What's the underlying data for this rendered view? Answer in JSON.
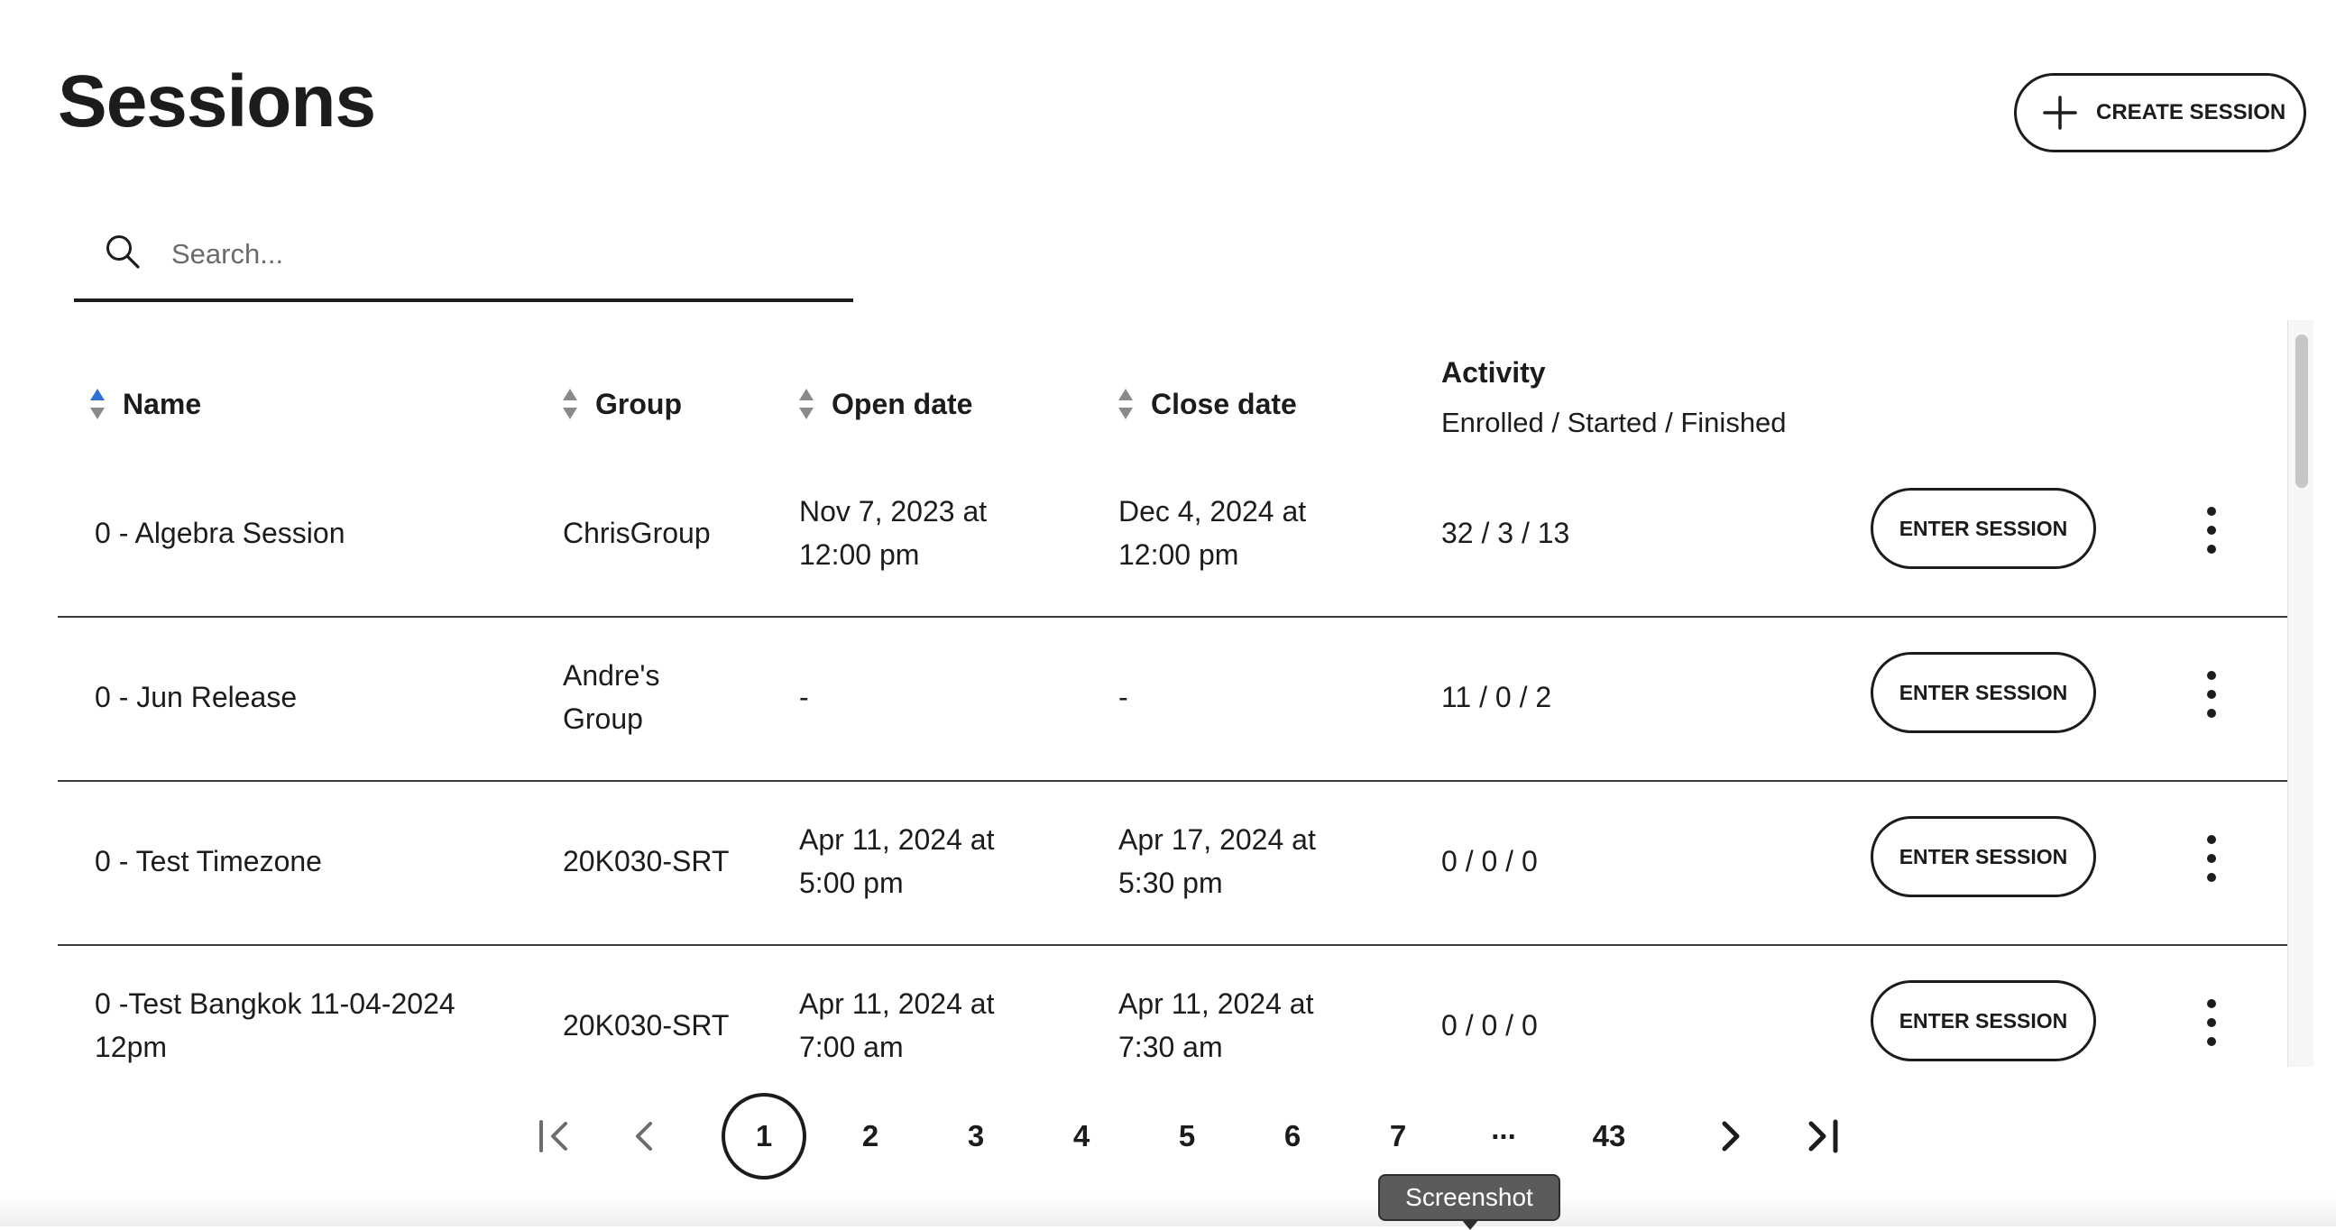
{
  "page": {
    "title": "Sessions",
    "create_button_label": "CREATE SESSION"
  },
  "search": {
    "placeholder": "Search...",
    "value": ""
  },
  "table": {
    "headers": {
      "name": "Name",
      "group": "Group",
      "open_date": "Open date",
      "close_date": "Close date",
      "activity": "Activity",
      "activity_sub": "Enrolled / Started / Finished"
    },
    "sorted_column": "name",
    "sort_direction": "ascending",
    "enter_label": "ENTER SESSION",
    "rows": [
      {
        "name": [
          "0 - Algebra Session"
        ],
        "group": [
          "ChrisGroup"
        ],
        "open": [
          "Nov 7, 2023 at",
          "12:00 pm"
        ],
        "close": [
          "Dec 4, 2024 at",
          "12:00 pm"
        ],
        "activity": "32 / 3 / 13"
      },
      {
        "name": [
          "0 - Jun Release"
        ],
        "group": [
          "Andre's",
          "Group"
        ],
        "open": [
          "-"
        ],
        "close": [
          "-"
        ],
        "activity": "11 / 0 / 2"
      },
      {
        "name": [
          "0 - Test Timezone"
        ],
        "group": [
          "20K030-SRT"
        ],
        "open": [
          "Apr 11, 2024 at",
          "5:00 pm"
        ],
        "close": [
          "Apr 17, 2024 at",
          "5:30 pm"
        ],
        "activity": "0 / 0 / 0"
      },
      {
        "name": [
          "0 -Test Bangkok 11-04-2024",
          "12pm"
        ],
        "group": [
          "20K030-SRT"
        ],
        "open": [
          "Apr 11, 2024 at",
          "7:00 am"
        ],
        "close": [
          "Apr 11, 2024 at",
          "7:30 am"
        ],
        "activity": "0 / 0 / 0"
      }
    ]
  },
  "pagination": {
    "current": "1",
    "pages": [
      "1",
      "2",
      "3",
      "4",
      "5",
      "6",
      "7",
      "...",
      "43"
    ]
  },
  "tooltip": {
    "text": "Screenshot"
  },
  "colors": {
    "text": "#1c1c1c",
    "sort_active": "#2f6fd6",
    "sort_inactive": "#8a8a8a",
    "tooltip_bg": "#5b5b5b"
  },
  "icons": {
    "create": "plus-icon",
    "search": "search-icon",
    "sort": "sort-icon",
    "row_menu": "kebab-menu-icon",
    "first": "first-page-icon",
    "prev": "prev-page-icon",
    "next": "next-page-icon",
    "last": "last-page-icon"
  }
}
